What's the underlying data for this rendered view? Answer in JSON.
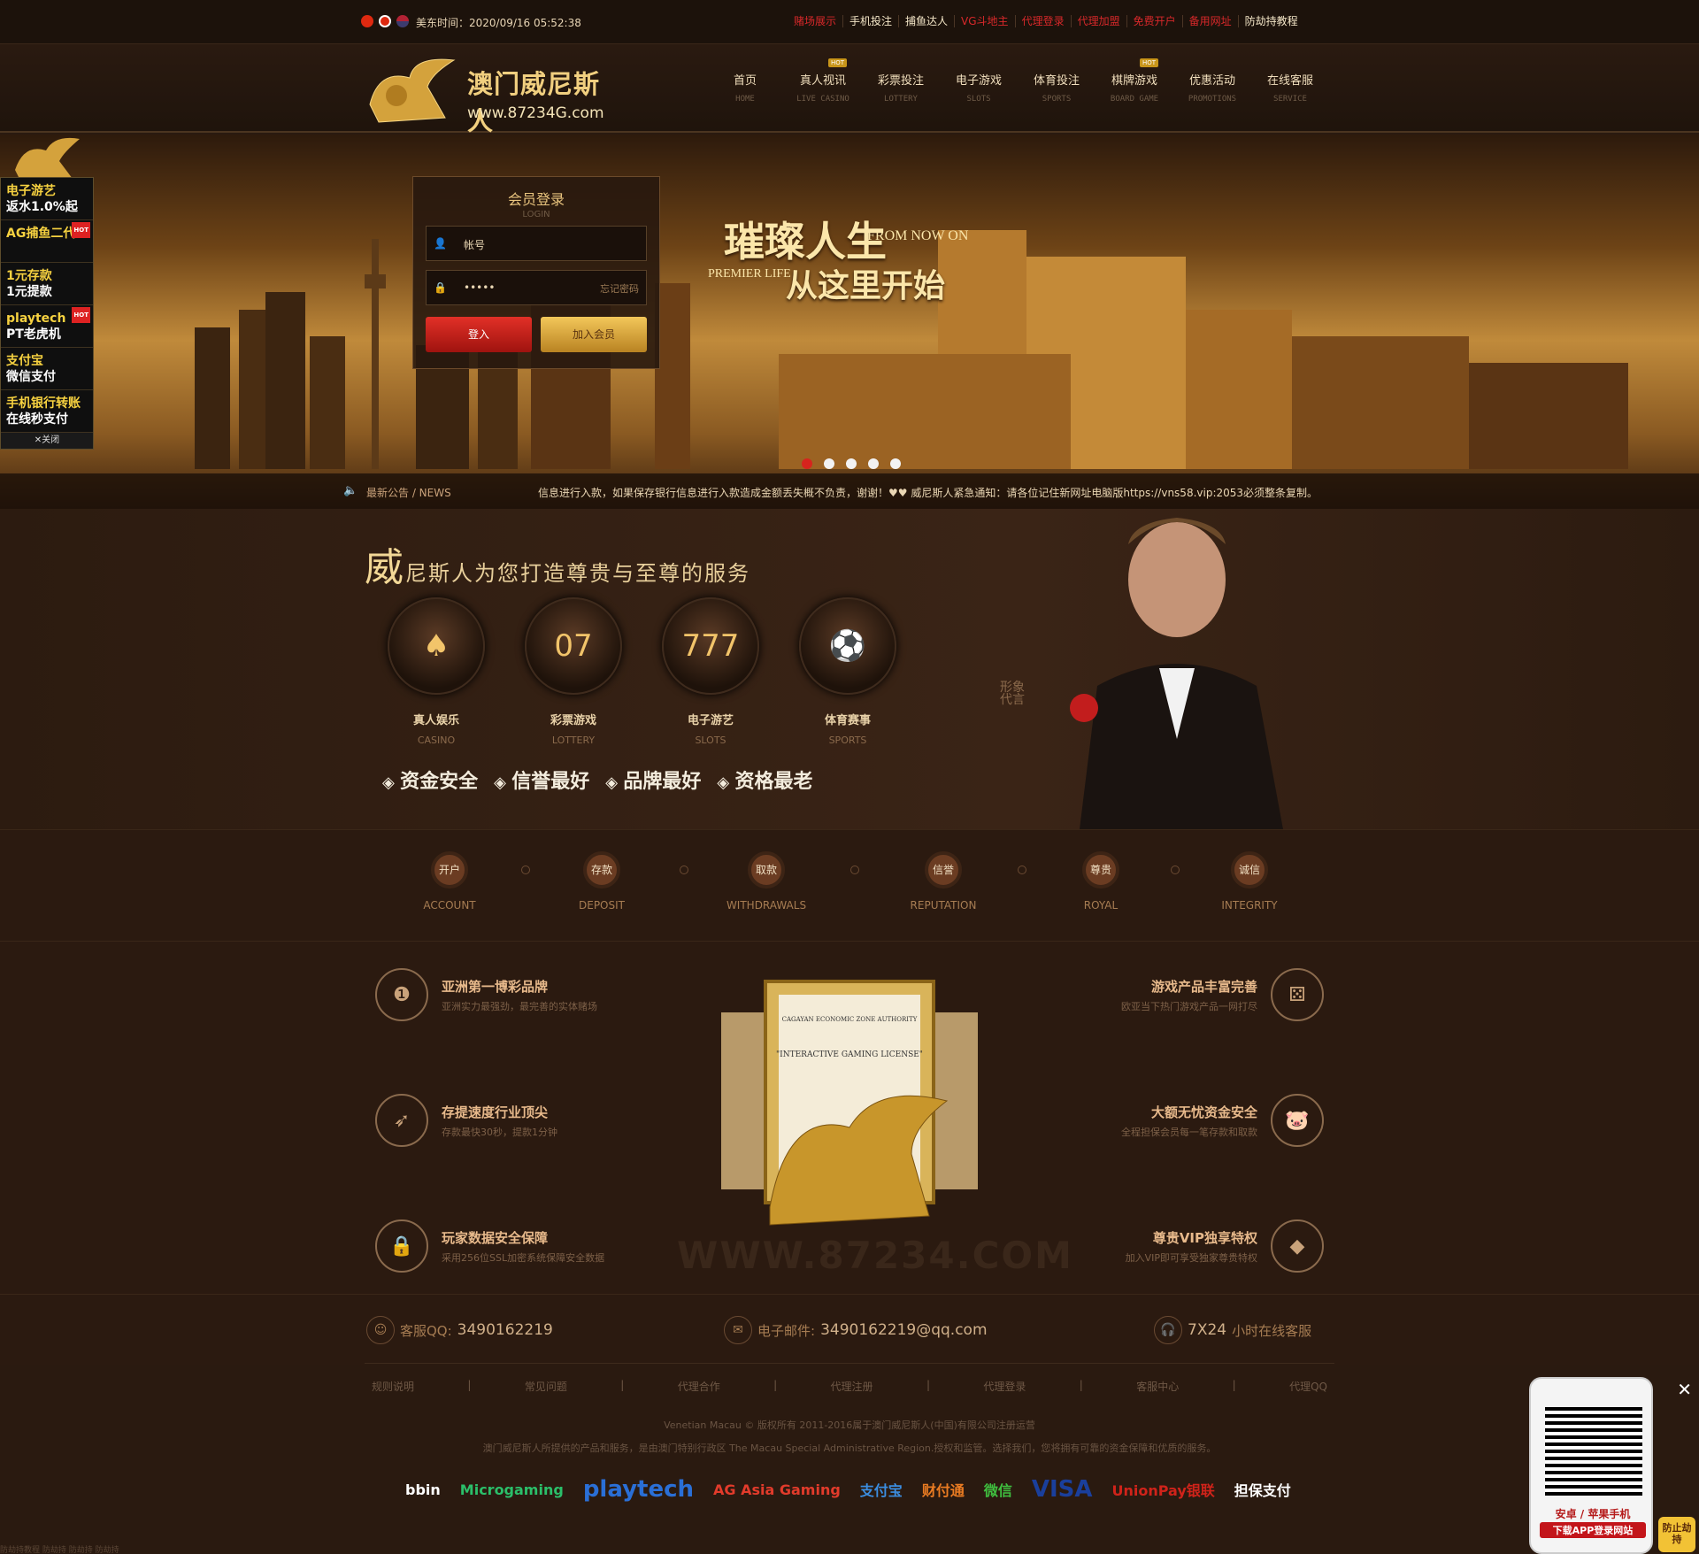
{
  "topbar": {
    "time": "美东时间：2020/09/16 05:52:38",
    "links": [
      "赌场展示",
      "手机投注",
      "捕鱼达人",
      "VG斗地主",
      "代理登录",
      "代理加盟",
      "免费开户",
      "备用网址",
      "防劫持教程"
    ],
    "link_colors": [
      "#d8282a",
      "#f5e7c8",
      "#f5e7c8",
      "#d8282a",
      "#d8282a",
      "#d8282a",
      "#d8282a",
      "#d8282a",
      "#f5e7c8"
    ]
  },
  "header": {
    "logo_name": "澳门威尼斯人",
    "logo_url": "www.87234G.com",
    "nav": [
      {
        "zh": "首页",
        "en": "HOME",
        "hot": false
      },
      {
        "zh": "真人视讯",
        "en": "LIVE CASINO",
        "hot": true
      },
      {
        "zh": "彩票投注",
        "en": "LOTTERY",
        "hot": false
      },
      {
        "zh": "电子游戏",
        "en": "SLOTS",
        "hot": false
      },
      {
        "zh": "体育投注",
        "en": "SPORTS",
        "hot": false
      },
      {
        "zh": "棋牌游戏",
        "en": "BOARD GAME",
        "hot": true
      },
      {
        "zh": "优惠活动",
        "en": "PROMOTIONS",
        "hot": false
      },
      {
        "zh": "在线客服",
        "en": "SERVICE",
        "hot": false
      }
    ],
    "hot_label": "HOT"
  },
  "banner": {
    "slogan_main": "璀璨人生",
    "slogan_en1": "FROM NOW ON",
    "slogan_en2": "PREMIER LIFE",
    "slogan_sub": "从这里开始",
    "slides": 5,
    "active_slide": 1
  },
  "news": {
    "label": "最新公告 / NEWS",
    "text": "信息进行入款，如果保存银行信息进行入款造成金额丢失概不负责，谢谢！♥♥ 威尼斯人紧急通知：请各位记住新网址电脑版https://vns58.vip:2053必须整条复制。"
  },
  "login": {
    "title": "会员登录",
    "subtitle": "LOGIN",
    "username_placeholder": "帐号",
    "password_value": "•••••",
    "forgot": "忘记密码",
    "login_button": "登入",
    "join_button": "加入会员"
  },
  "side_float": {
    "items": [
      {
        "line1": "电子游艺",
        "line2": "返水1.0%起",
        "hot": false
      },
      {
        "line1": "AG捕鱼二代",
        "line2": "",
        "hot": true
      },
      {
        "line1": "1元存款",
        "line2": "1元提款",
        "hot": false
      },
      {
        "line1": "playtech",
        "line2": "PT老虎机",
        "hot": true
      },
      {
        "line1": "支付宝",
        "line2": "微信支付",
        "hot": false
      },
      {
        "line1": "手机银行转账",
        "line2": "在线秒支付",
        "hot": false
      }
    ],
    "close": "✕关闭"
  },
  "services": {
    "title_first": "威",
    "title_rest": "尼斯人为您打造尊贵与至尊的服务",
    "items": [
      {
        "zh": "真人娱乐",
        "en": "CASINO"
      },
      {
        "zh": "彩票游戏",
        "en": "LOTTERY"
      },
      {
        "zh": "电子游艺",
        "en": "SLOTS"
      },
      {
        "zh": "体育赛事",
        "en": "SPORTS"
      }
    ],
    "badges": [
      "资金安全",
      "信誉最好",
      "品牌最好",
      "资格最老"
    ],
    "spokes_text": "形象代言"
  },
  "steps": [
    {
      "zh": "开户",
      "en": "ACCOUNT"
    },
    {
      "zh": "存款",
      "en": "DEPOSIT"
    },
    {
      "zh": "取款",
      "en": "WITHDRAWALS"
    },
    {
      "zh": "信誉",
      "en": "REPUTATION"
    },
    {
      "zh": "尊贵",
      "en": "ROYAL"
    },
    {
      "zh": "诚信",
      "en": "INTEGRITY"
    }
  ],
  "features": {
    "left": [
      {
        "title": "亚洲第一博彩品牌",
        "desc": "亚洲实力最强劲，最完善的实体赌场"
      },
      {
        "title": "存提速度行业顶尖",
        "desc": "存款最快30秒，提款1分钟"
      },
      {
        "title": "玩家数据安全保障",
        "desc": "采用256位SSL加密系统保障安全数据"
      }
    ],
    "right": [
      {
        "title": "游戏产品丰富完善",
        "desc": "欧亚当下热门游戏产品一网打尽"
      },
      {
        "title": "大额无忧资金安全",
        "desc": "全程担保会员每一笔存款和取款"
      },
      {
        "title": "尊贵VIP独享特权",
        "desc": "加入VIP即可享受独家尊贵特权"
      }
    ],
    "cert_title": "\"INTERACTIVE GAMING LICENSE\"",
    "cert_header": "CAGAYAN ECONOMIC ZONE AUTHORITY",
    "watermark": "WWW.87234.COM"
  },
  "contact": {
    "qq_label": "客服QQ:",
    "qq": "3490162219",
    "email_label": "电子邮件:",
    "email": "3490162219@qq.com",
    "service_num": "7X24",
    "service_text": "小时在线客服"
  },
  "footer": {
    "links": [
      "规则说明",
      "常见问题",
      "代理合作",
      "代理注册",
      "代理登录",
      "客服中心",
      "代理QQ"
    ],
    "copyright": "Venetian Macau © 版权所有 2011-2016属于澳门威尼斯人(中国)有限公司注册运营",
    "copyright2": "澳门威尼斯人所提供的产品和服务，是由澳门特别行政区 The Macau Special Administrative Region.授权和监管。选择我们，您将拥有可靠的资金保障和优质的服务。",
    "partners": [
      "bbin",
      "Microgaming",
      "playtech",
      "AG Asia Gaming",
      "支付宝",
      "财付通",
      "微信",
      "VISA",
      "UnionPay银联",
      "担保支付"
    ],
    "bottom_text": "防劫持教程 防劫持 防劫持 防劫持"
  },
  "qr": {
    "text1": "安卓 / 苹果手机",
    "text2": "下载APP登录网站",
    "anti": "防止劫持",
    "close": "✕"
  }
}
